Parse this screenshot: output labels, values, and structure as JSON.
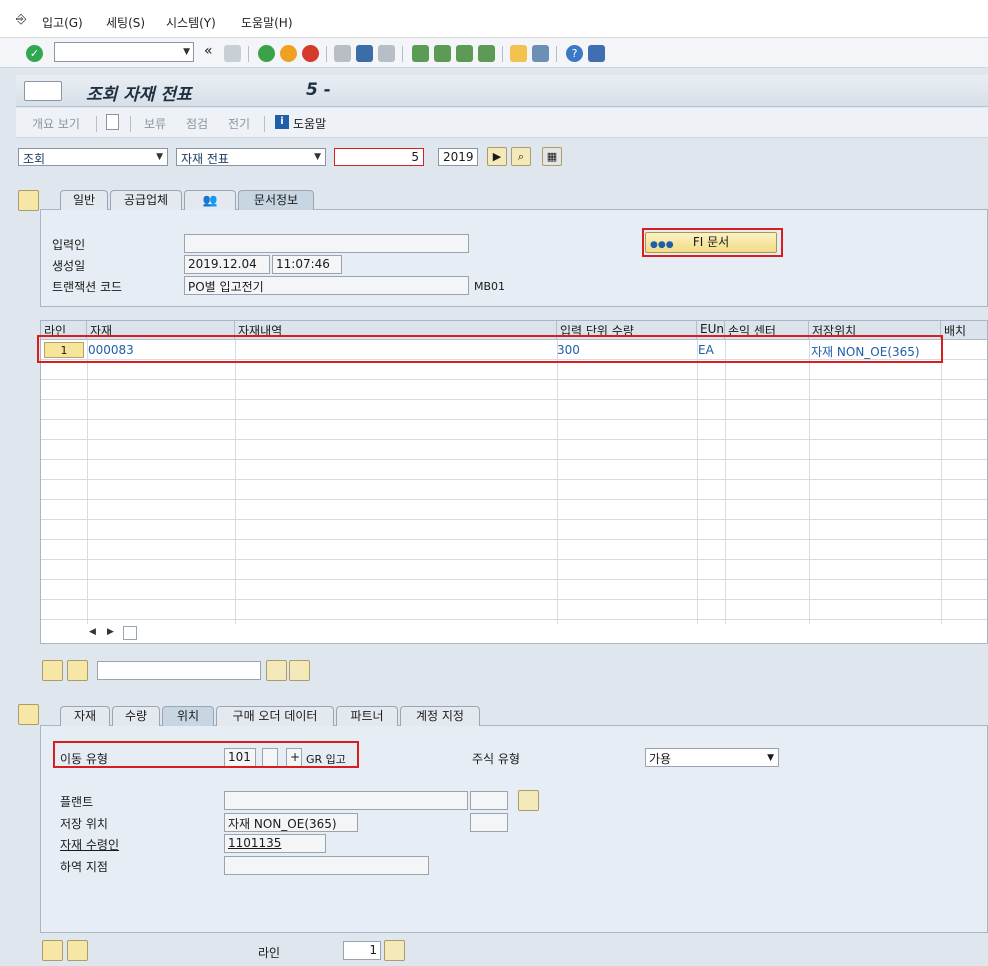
{
  "menu": {
    "items": [
      "입고(G)",
      "세팅(S)",
      "시스템(Y)",
      "도움말(H)"
    ]
  },
  "toolbar": {
    "command_value": "",
    "nav_symbol": "«"
  },
  "title": {
    "text": "조회 자재 전표",
    "doc_suffix": "5 -"
  },
  "app_toolbar": {
    "overview": "개요 보기",
    "hold": "보류",
    "check": "점검",
    "post": "전기",
    "help": "도움말"
  },
  "selection": {
    "action": "조회",
    "ref_doc": "자재 전표",
    "doc_number": "5",
    "year": "2019"
  },
  "header_tabs": [
    "일반",
    "공급업체",
    "문서정보"
  ],
  "doc_info": {
    "entered_by_label": "입력인",
    "entered_by_value": "",
    "created_label": "생성일",
    "created_date": "2019.12.04",
    "created_time": "11:07:46",
    "tcode_label": "트랜잭션 코드",
    "tcode_desc": "PO별 입고전기",
    "tcode": "MB01",
    "fi_button": "FI 문서"
  },
  "table": {
    "columns": [
      "라인",
      "자재",
      "자재내역",
      "입력 단위 수량",
      "EUn",
      "손익 센터",
      "저장위치",
      "배치"
    ],
    "rows": [
      {
        "line": "1",
        "material": "000083",
        "desc": "",
        "qty": "300",
        "eun": "EA",
        "profit_center": "",
        "storage": "자재 NON_OE(365)",
        "batch": ""
      }
    ]
  },
  "detail_tabs": [
    "자재",
    "수량",
    "위치",
    "구매 오더 데이터",
    "파트너",
    "계정 지정"
  ],
  "detail": {
    "movement_label": "이동 유형",
    "movement_code": "101",
    "movement_ind": "",
    "movement_sign": "+",
    "movement_text": "GR 입고",
    "stock_type_label": "주식 유형",
    "stock_type_value": "가용",
    "plant_label": "플랜트",
    "storage_label": "저장 위치",
    "storage_value": "자재 NON_OE(365)",
    "recipient_label": "자재 수령인",
    "recipient_value": "1101135",
    "unloading_label": "하역 지점",
    "line_label": "라인",
    "line_value": "1"
  },
  "colors": {
    "highlight": "#d81e1e",
    "link": "#1f5ea8",
    "button_yellow": "#f4e9b8"
  }
}
